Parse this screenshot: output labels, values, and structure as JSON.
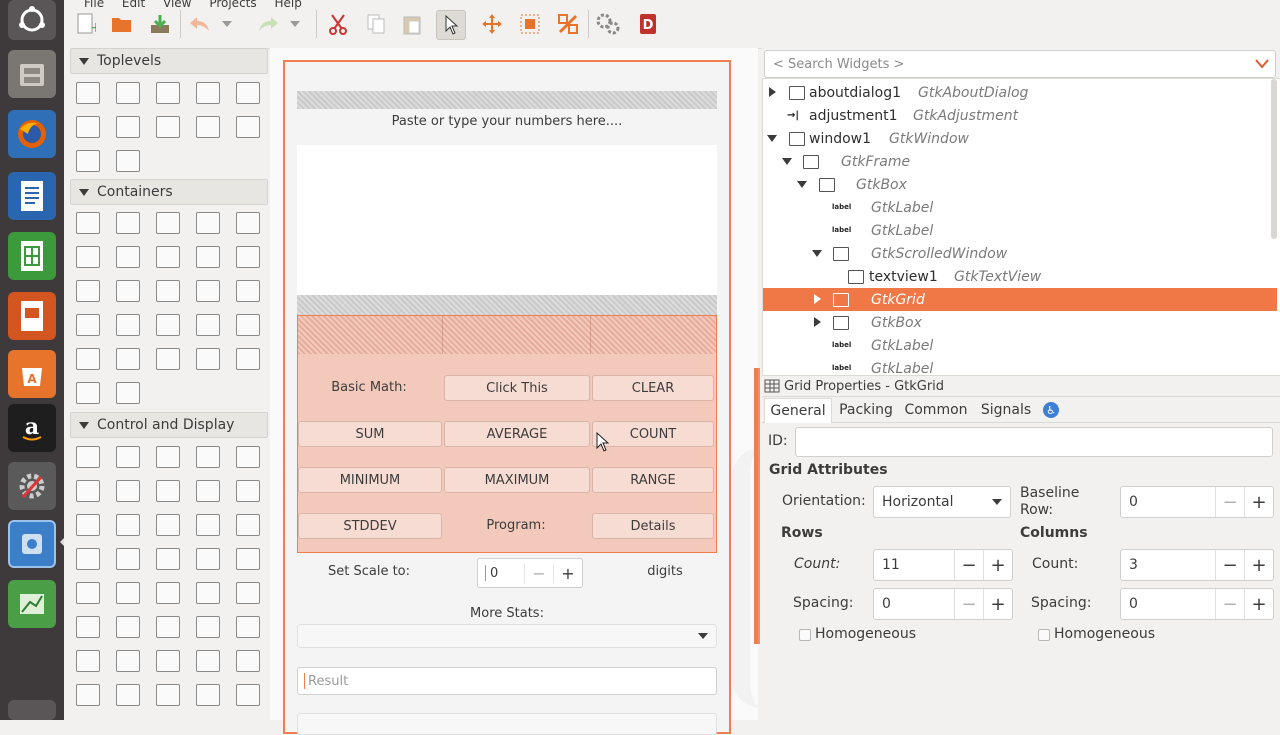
{
  "menubar": {
    "items": [
      "File",
      "Edit",
      "View",
      "Projects",
      "Help"
    ]
  },
  "palette": {
    "toplevels": "Toplevels",
    "containers": "Containers",
    "control": "Control and Display"
  },
  "canvas": {
    "paste_label": "Paste or type your numbers here....",
    "basic_math": "Basic Math:",
    "click_this": "Click This",
    "clear": "CLEAR",
    "sum": "SUM",
    "average": "AVERAGE",
    "count": "COUNT",
    "minimum": "MINIMUM",
    "maximum": "MAXIMUM",
    "range": "RANGE",
    "stddev": "STDDEV",
    "program": "Program:",
    "details": "Details",
    "set_scale": "Set Scale to:",
    "scale_value": "0",
    "digits": "digits",
    "more_stats": "More Stats:",
    "result_placeholder": "Result"
  },
  "search": {
    "placeholder": "< Search Widgets >"
  },
  "tree": [
    {
      "name": "aboutdialog1",
      "cls": "GtkAboutDialog"
    },
    {
      "name": "adjustment1",
      "cls": "GtkAdjustment"
    },
    {
      "name": "window1",
      "cls": "GtkWindow"
    },
    {
      "name": "",
      "cls": "GtkFrame"
    },
    {
      "name": "",
      "cls": "GtkBox"
    },
    {
      "name": "",
      "cls": "GtkLabel"
    },
    {
      "name": "",
      "cls": "GtkLabel"
    },
    {
      "name": "",
      "cls": "GtkScrolledWindow"
    },
    {
      "name": "textview1",
      "cls": "GtkTextView"
    },
    {
      "name": "",
      "cls": "GtkGrid"
    },
    {
      "name": "",
      "cls": "GtkBox"
    },
    {
      "name": "",
      "cls": "GtkLabel"
    },
    {
      "name": "",
      "cls": "GtkLabel"
    }
  ],
  "props": {
    "title": "Grid Properties - GtkGrid",
    "tabs": [
      "General",
      "Packing",
      "Common",
      "Signals"
    ],
    "id_label": "ID:",
    "grid_attributes": "Grid Attributes",
    "orientation_label": "Orientation:",
    "orientation_value": "Horizontal",
    "baseline_label": "Baseline Row:",
    "baseline_value": "0",
    "rows": "Rows",
    "columns": "Columns",
    "count_label_rows": "Count:",
    "count_label_cols": "Count:",
    "rows_count": "11",
    "cols_count": "3",
    "spacing_label_rows": "Spacing:",
    "spacing_label_cols": "Spacing:",
    "rows_spacing": "0",
    "cols_spacing": "0",
    "homogeneous_rows": "Homogeneous",
    "homogeneous_cols": "Homogeneous"
  },
  "colors": {
    "accent": "#ef7f4f",
    "selection": "#f07746"
  }
}
